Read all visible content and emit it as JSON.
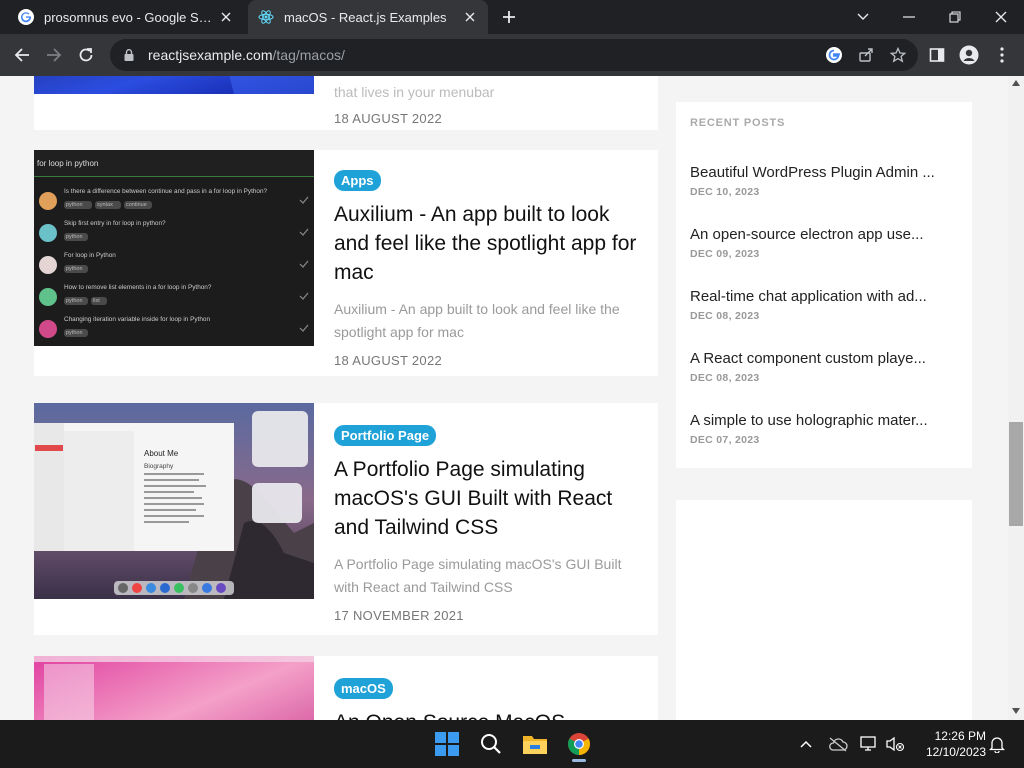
{
  "browser": {
    "tabs": [
      {
        "title": "prosomnus evo - Google Search",
        "icon": "google-icon"
      },
      {
        "title": "macOS - React.js Examples",
        "icon": "react-icon"
      }
    ],
    "url_domain": "reactjsexample.com",
    "url_path": "/tag/macos/"
  },
  "posts": {
    "partial_top": {
      "excerpt_tail": "that lives in your menubar",
      "date": "18 AUGUST 2022"
    },
    "items": [
      {
        "badge": "Apps",
        "title": "Auxilium - An app built to look and feel like the spotlight app for mac",
        "excerpt": "Auxilium - An app built to look and feel like the spotlight app for mac",
        "date": "18 AUGUST 2022",
        "thumb": {
          "search": "for loop in python",
          "rows": [
            {
              "q": "Is there a difference between continue and pass in a for loop in Python?",
              "tags": [
                "python",
                "syntax",
                "continue"
              ]
            },
            {
              "q": "Skip first entry in for loop in python?",
              "tags": [
                "python"
              ]
            },
            {
              "q": "For loop in Python",
              "tags": [
                "python"
              ]
            },
            {
              "q": "How to remove list elements in a for loop in Python?",
              "tags": [
                "python",
                "list"
              ]
            },
            {
              "q": "Changing iteration variable inside for loop in Python",
              "tags": [
                "python"
              ]
            }
          ]
        }
      },
      {
        "badge": "Portfolio Page",
        "title": "A Portfolio Page simulating macOS's GUI Built with React and Tailwind CSS",
        "excerpt": "A Portfolio Page simulating macOS's GUI Built with React and Tailwind CSS",
        "date": "17 NOVEMBER 2021",
        "thumb": {
          "window_heading": "About Me",
          "sub_heading": "Biography"
        }
      },
      {
        "badge": "macOS",
        "title": "An Open Source MacOS"
      }
    ]
  },
  "sidebar": {
    "heading": "RECENT POSTS",
    "items": [
      {
        "title": "Beautiful WordPress Plugin Admin ...",
        "date": "DEC 10, 2023"
      },
      {
        "title": "An open-source electron app use...",
        "date": "DEC 09, 2023"
      },
      {
        "title": "Real-time chat application with ad...",
        "date": "DEC 08, 2023"
      },
      {
        "title": "A React component custom playe...",
        "date": "DEC 08, 2023"
      },
      {
        "title": "A simple to use holographic mater...",
        "date": "DEC 07, 2023"
      }
    ]
  },
  "taskbar": {
    "time": "12:26 PM",
    "date": "12/10/2023"
  },
  "colors": {
    "badge": "#1fa2d8",
    "chrome_dark": "#202124",
    "chrome_toolbar": "#35363a",
    "taskbar": "#1b1b1b"
  }
}
